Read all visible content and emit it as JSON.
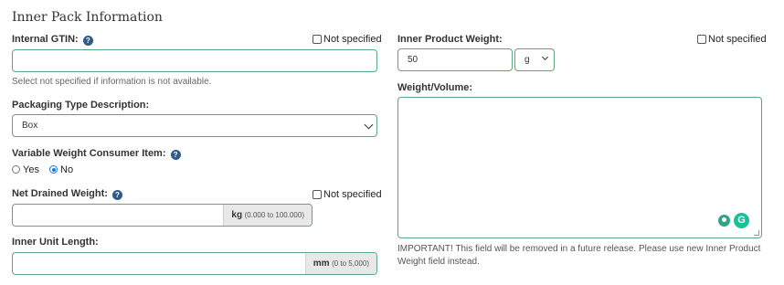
{
  "section_title": "Inner Pack Information",
  "help_glyph": "?",
  "internal_gtin": {
    "label": "Internal GTIN:",
    "not_specified": "Not specified",
    "value": "",
    "hint": "Select not specified if information is not available."
  },
  "packaging_type": {
    "label": "Packaging Type Description:",
    "selected": "Box"
  },
  "variable_weight": {
    "label": "Variable Weight Consumer Item:",
    "options": [
      "Yes",
      "No"
    ],
    "selected": "No"
  },
  "net_drained_weight": {
    "label": "Net Drained Weight:",
    "not_specified": "Not specified",
    "value": "",
    "unit": "kg",
    "range": "(0.000 to 100.000)"
  },
  "inner_unit_length": {
    "label": "Inner Unit Length:",
    "value": "",
    "unit": "mm",
    "range": "(0 to 5,000)"
  },
  "inner_product_weight": {
    "label": "Inner Product Weight:",
    "not_specified": "Not specified",
    "value": "50",
    "unit_selected": "g"
  },
  "weight_volume": {
    "label": "Weight/Volume:",
    "value": "",
    "note": "IMPORTANT! This field will be removed in a future release. Please use new Inner Product Weight field instead."
  },
  "colors": {
    "field_border": "#57a87c",
    "help_icon": "#2f5a8a",
    "radio_selected": "#1a73e8",
    "grammarly": "#15c39a"
  }
}
